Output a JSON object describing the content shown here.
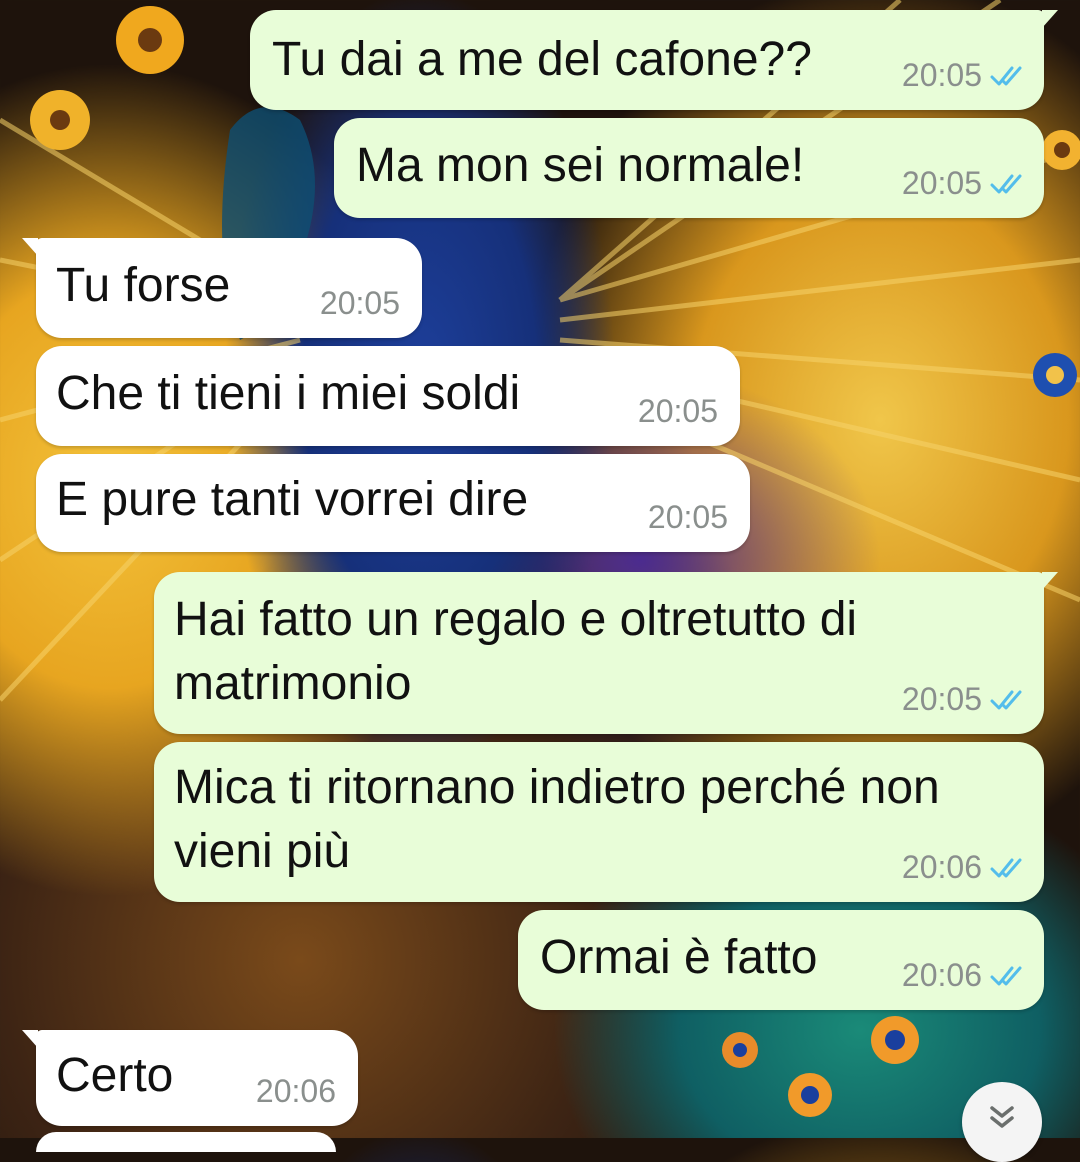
{
  "messages": [
    {
      "dir": "out",
      "text": "Tu dai a me del cafone??",
      "time": "20:05",
      "status": "read"
    },
    {
      "dir": "out",
      "text": "Ma mon sei normale!",
      "time": "20:05",
      "status": "read"
    },
    {
      "dir": "in",
      "text": "Tu forse",
      "time": "20:05"
    },
    {
      "dir": "in",
      "text": "Che ti tieni i miei soldi",
      "time": "20:05"
    },
    {
      "dir": "in",
      "text": "E pure tanti vorrei dire",
      "time": "20:05"
    },
    {
      "dir": "out",
      "text": "Hai fatto un regalo e oltretutto di\nmatrimonio",
      "time": "20:05",
      "status": "read"
    },
    {
      "dir": "out",
      "text": "Mica ti ritornano indietro perché non\nvieni più",
      "time": "20:06",
      "status": "read"
    },
    {
      "dir": "out",
      "text": "Ormai è fatto",
      "time": "20:06",
      "status": "read"
    },
    {
      "dir": "in",
      "text": "Certo",
      "time": "20:06"
    }
  ],
  "icons": {
    "read_ticks": "double-check-icon",
    "scroll_down": "chevron-double-down-icon"
  },
  "colors": {
    "outgoing_bubble": "#e8fdd8",
    "incoming_bubble": "#ffffff",
    "read_tick": "#53bdeb",
    "time_text": "#8a8f8d"
  }
}
